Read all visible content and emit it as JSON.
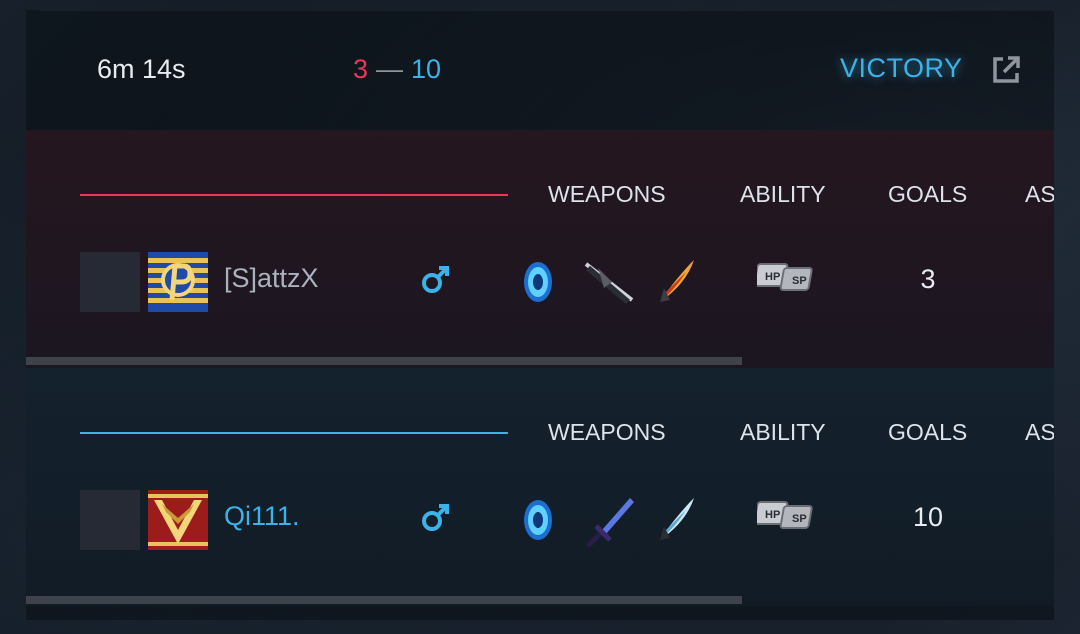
{
  "match": {
    "duration": "6m 14s",
    "score_red": "3",
    "score_dash": "—",
    "score_blue": "10",
    "result": "VICTORY",
    "share_icon": "external-link-icon"
  },
  "columns": {
    "weapons": "WEAPONS",
    "ability": "ABILITY",
    "goals": "GOALS",
    "assists": "AS"
  },
  "teams": [
    {
      "color": "#e8385a",
      "player": {
        "name": "[S]attzX",
        "gender_icon": "male-symbol-icon",
        "emblem_icon": "gold-p-emblem-icon",
        "weapons": [
          "blue-orb-shield-icon",
          "dark-chain-blade-icon",
          "fire-claw-icon"
        ],
        "ability": "hp-sp-ability-icon",
        "goals": "3"
      }
    },
    {
      "color": "#3bb3e8",
      "player": {
        "name": "Qi111.",
        "gender_icon": "male-symbol-icon",
        "emblem_icon": "gold-chevron-emblem-icon",
        "weapons": [
          "blue-orb-shield-icon",
          "purple-sword-icon",
          "ice-claw-icon"
        ],
        "ability": "hp-sp-ability-icon",
        "goals": "10"
      }
    }
  ]
}
